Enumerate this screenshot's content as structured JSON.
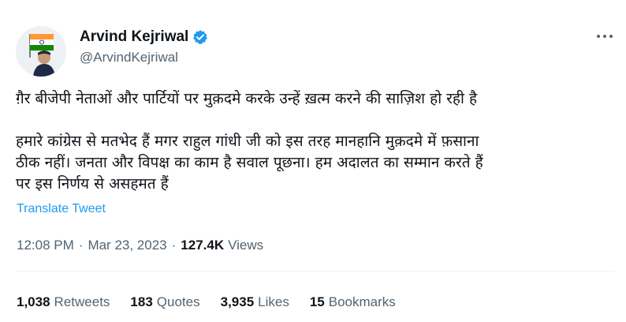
{
  "author": {
    "display_name": "Arvind Kejriwal",
    "handle": "@ArvindKejriwal",
    "verified_icon": "verified-badge-icon",
    "avatar_icon": "avatar-with-flag"
  },
  "colors": {
    "accent": "#1d9bf0",
    "text_primary": "#0f1419",
    "text_secondary": "#536471"
  },
  "tweet": {
    "paragraph_1": "ग़ैर बीजेपी नेताओं और पार्टियों पर मुक़दमे करके उन्हें ख़त्म करने की साज़िश हो रही है",
    "paragraph_2": "हमारे कांग्रेस से मतभेद हैं मगर राहुल गांधी जी को इस तरह मानहानि मुक़दमे में फ़साना\nठीक नहीं। जनता और विपक्ष का काम है सवाल पूछना। हम अदालत का सम्मान करते हैं\nपर इस निर्णय से असहमत हैं",
    "translate_label": "Translate Tweet"
  },
  "meta": {
    "time": "12:08 PM",
    "separator": "·",
    "date": "Mar 23, 2023",
    "views_count": "127.4K",
    "views_label": "Views"
  },
  "stats": [
    {
      "count": "1,038",
      "label": "Retweets"
    },
    {
      "count": "183",
      "label": "Quotes"
    },
    {
      "count": "3,935",
      "label": "Likes"
    },
    {
      "count": "15",
      "label": "Bookmarks"
    }
  ]
}
